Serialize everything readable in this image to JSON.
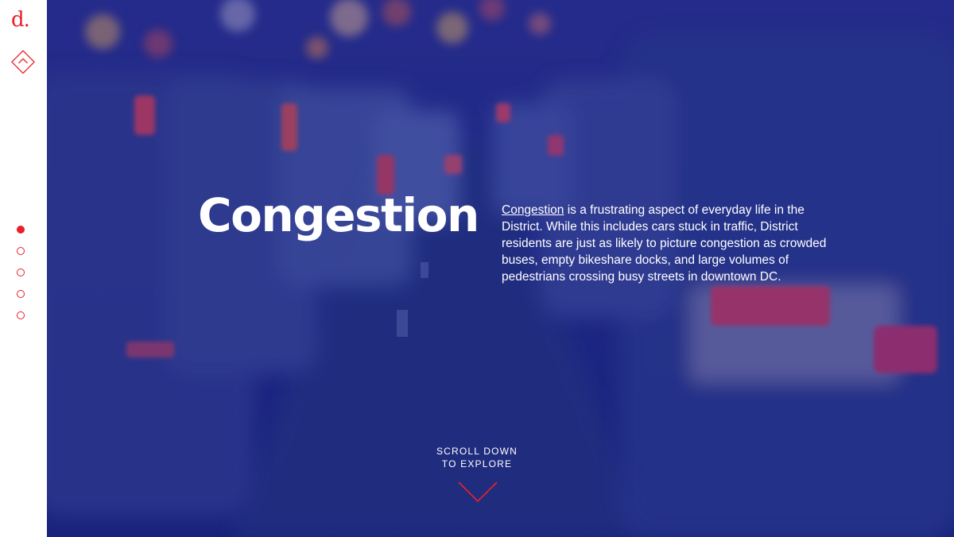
{
  "logo": {
    "text": "d."
  },
  "sidebar": {
    "up_icon": "chevron-up-icon",
    "nav_dots": [
      {
        "active": true
      },
      {
        "active": false
      },
      {
        "active": false
      },
      {
        "active": false
      },
      {
        "active": false
      }
    ]
  },
  "hero": {
    "title": "Congestion",
    "term": "Congestion",
    "body": " is a frustrating aspect of everyday life in the District. While this includes cars stuck in traffic, District residents are just as likely to picture congestion as crowded buses, empty bikeshare docks, and large volumes of pedestrians crossing busy streets in downtown DC.",
    "scroll_line1": "SCROLL DOWN",
    "scroll_line2": "TO EXPLORE",
    "scroll_icon": "chevron-down-icon"
  },
  "colors": {
    "accent": "#e8202a",
    "overlay": "#1c248c",
    "sidebar_bg": "#ffffff"
  }
}
